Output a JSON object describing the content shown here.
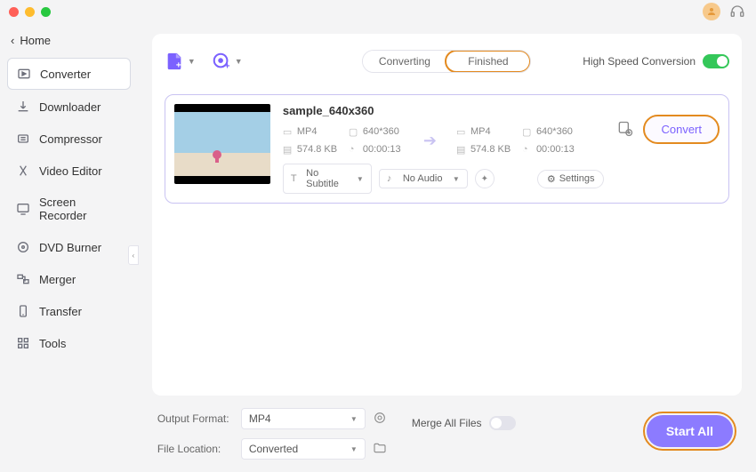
{
  "sidebar": {
    "home": "Home",
    "items": [
      {
        "label": "Converter",
        "active": true
      },
      {
        "label": "Downloader"
      },
      {
        "label": "Compressor"
      },
      {
        "label": "Video Editor"
      },
      {
        "label": "Screen Recorder"
      },
      {
        "label": "DVD Burner"
      },
      {
        "label": "Merger"
      },
      {
        "label": "Transfer"
      },
      {
        "label": "Tools"
      }
    ]
  },
  "tabs": {
    "converting": "Converting",
    "finished": "Finished"
  },
  "high_speed_label": "High Speed Conversion",
  "file": {
    "name": "sample_640x360",
    "src": {
      "fmt": "MP4",
      "res": "640*360",
      "size": "574.8 KB",
      "dur": "00:00:13"
    },
    "dst": {
      "fmt": "MP4",
      "res": "640*360",
      "size": "574.8 KB",
      "dur": "00:00:13"
    },
    "subtitle": "No Subtitle",
    "audio": "No Audio",
    "settings": "Settings",
    "convert": "Convert"
  },
  "footer": {
    "output_format_label": "Output Format:",
    "output_format": "MP4",
    "file_location_label": "File Location:",
    "file_location": "Converted",
    "merge_label": "Merge All Files",
    "start_all": "Start All"
  }
}
